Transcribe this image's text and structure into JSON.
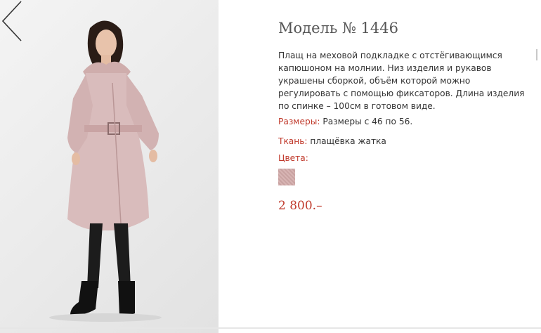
{
  "product": {
    "title": "Модель № 1446",
    "description": "Плащ на меховой подкладке с отстёгивающимся капюшоном на молнии. Низ изделия и рукавов украшены сборкой, объём которой можно регулировать с помощью фиксаторов. Длина изделия по спинке – 100см в готовом виде.",
    "sizes_label": "Размеры:",
    "sizes_value": "Размеры с 46 по 56.",
    "fabric_label": "Ткань:",
    "fabric_value": "плащёвка жатка",
    "colors_label": "Цвета:",
    "price": "2 800.–"
  },
  "icons": {
    "prev": "chevron-left-icon"
  },
  "colors": {
    "accent": "#c0392b",
    "swatch": "#d3adac",
    "coat": "#d9bcbc"
  }
}
